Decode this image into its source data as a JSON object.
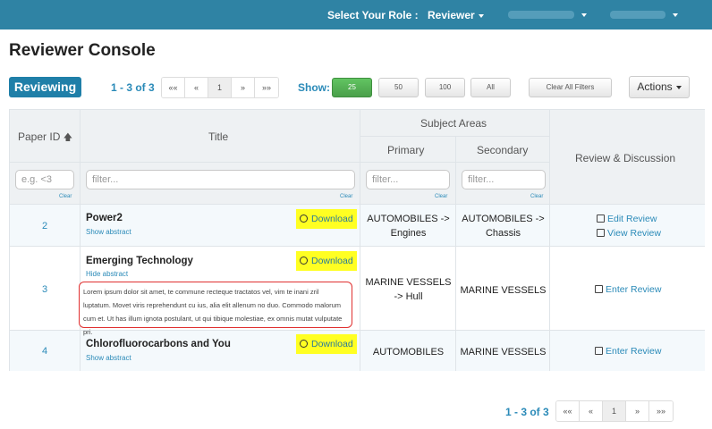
{
  "topbar": {
    "role_label": "Select Your Role :",
    "role_value": "Reviewer"
  },
  "page_title": "Reviewer Console",
  "controls": {
    "reviewing": "Reviewing",
    "range": "1 - 3 of 3",
    "pager": [
      "««",
      "«",
      "1",
      "»",
      "»»"
    ],
    "show_label": "Show:",
    "page_sizes": [
      "25",
      "50",
      "100",
      "All"
    ],
    "selected_page_size": "25",
    "clear_filters": "Clear All Filters",
    "actions": "Actions"
  },
  "table": {
    "headers": {
      "paper_id": "Paper ID",
      "title": "Title",
      "subject_areas": "Subject Areas",
      "primary": "Primary",
      "secondary": "Secondary",
      "review": "Review & Discussion"
    },
    "filters": {
      "paper_id_placeholder": "e.g. <3",
      "title_placeholder": "filter...",
      "primary_placeholder": "filter...",
      "secondary_placeholder": "filter...",
      "clear": "Clear"
    },
    "download_label": "Download",
    "rows": [
      {
        "id": "2",
        "title": "Power2",
        "abstract_link": "Show abstract",
        "primary": [
          "AUTOMOBILES ->",
          "Engines"
        ],
        "secondary": [
          "AUTOMOBILES ->",
          "Chassis"
        ],
        "actions": [
          "Edit Review",
          "View Review"
        ]
      },
      {
        "id": "3",
        "title": "Emerging Technology",
        "abstract_link": "Hide abstract",
        "abstract_text": "Lorem ipsum dolor sit amet, te commune recteque tractatos vel, vim te inani zril luptatum. Movet viris reprehendunt cu ius, alia elit allenum no duo. Commodo malorum cum et. Ut has illum ignota postulant, ut qui tibique molestiae, ex omnis mutat vulputate pri.",
        "primary": [
          "MARINE VESSELS",
          "-> Hull"
        ],
        "secondary": [
          "MARINE VESSELS"
        ],
        "actions": [
          "Enter Review"
        ]
      },
      {
        "id": "4",
        "title": "Chlorofluorocarbons and You",
        "abstract_link": "Show abstract",
        "primary": [
          "AUTOMOBILES"
        ],
        "secondary": [
          "MARINE VESSELS"
        ],
        "actions": [
          "Enter Review"
        ]
      }
    ]
  },
  "bottom": {
    "range": "1 - 3 of 3",
    "pager": [
      "««",
      "«",
      "1",
      "»",
      "»»"
    ]
  }
}
